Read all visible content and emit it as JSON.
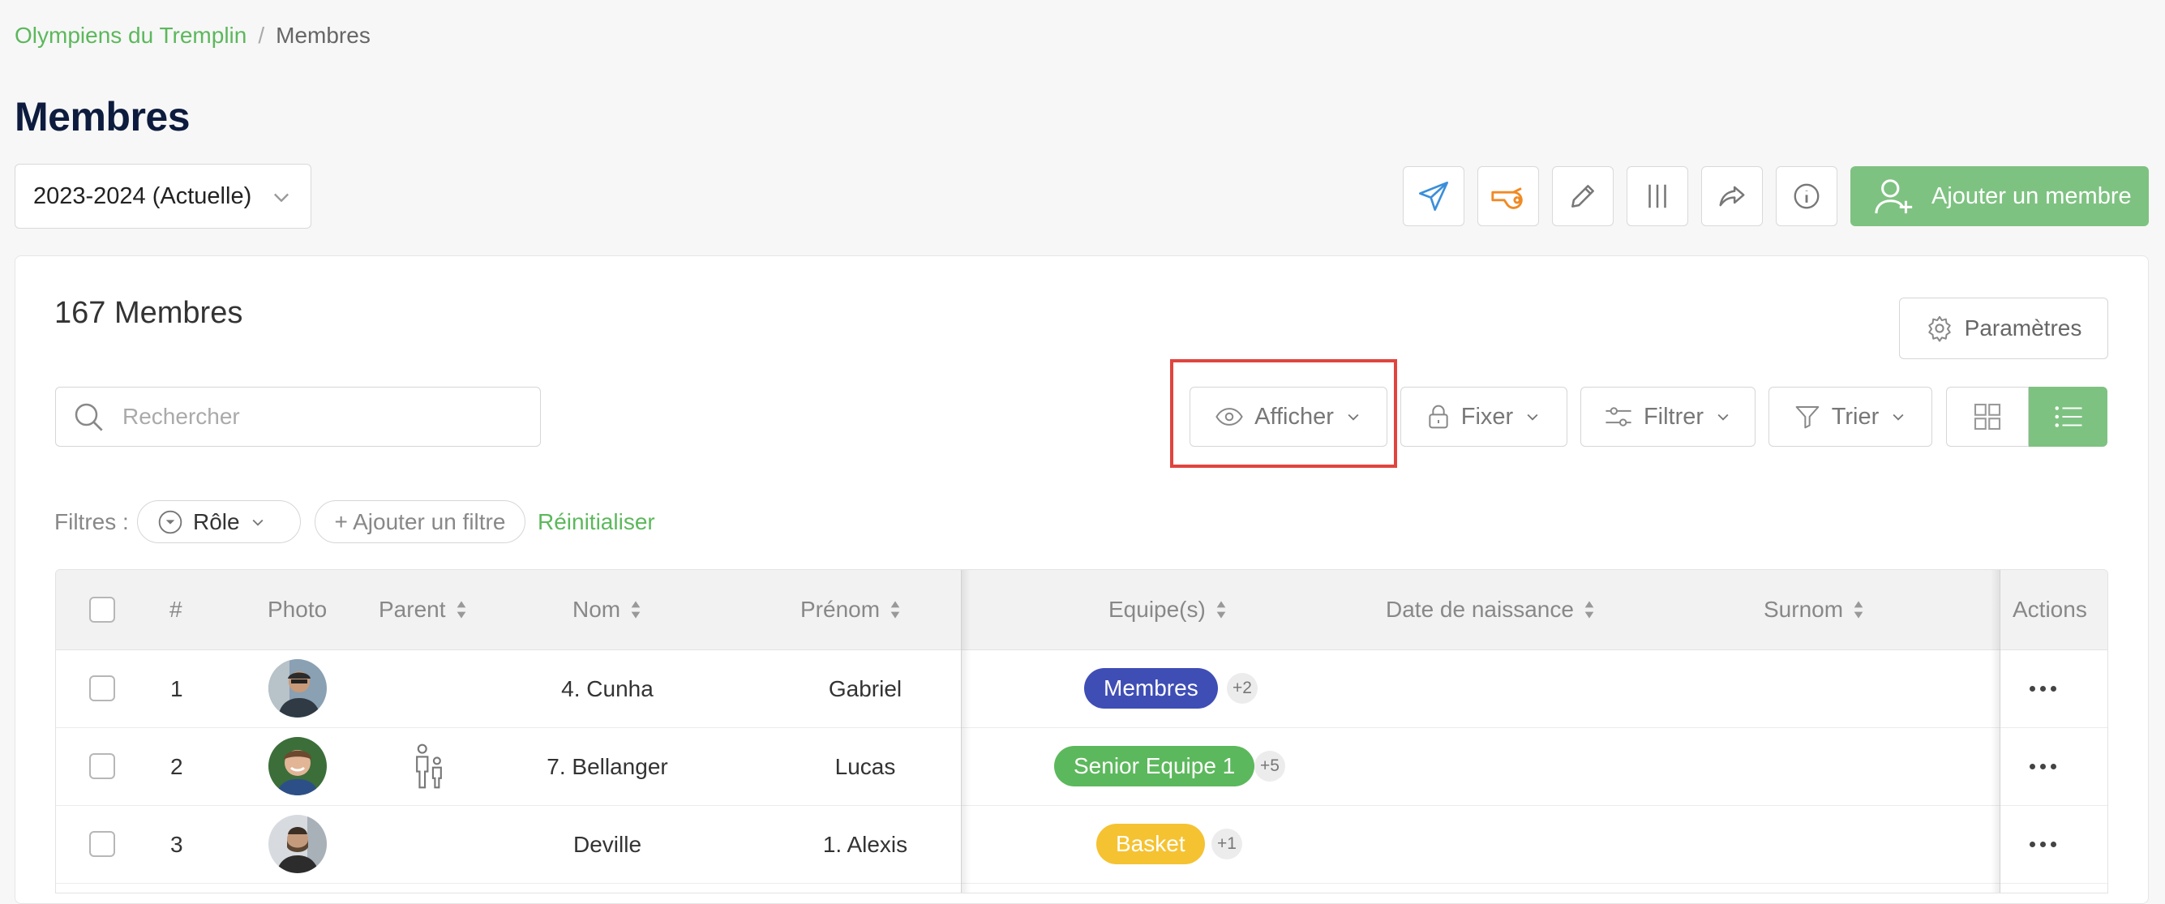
{
  "breadcrumb": {
    "club": "Olympiens du Tremplin",
    "separator": "/",
    "current": "Membres"
  },
  "page": {
    "title": "Membres"
  },
  "season": {
    "value": "2023-2024 (Actuelle)"
  },
  "toolbar": {
    "icons": [
      "send-icon",
      "whistle-icon",
      "pencil-icon",
      "columns-icon",
      "share-icon",
      "info-icon"
    ],
    "add_member_label": "Ajouter un membre"
  },
  "members": {
    "count_label": "167 Membres",
    "settings_label": "Paramètres",
    "search_placeholder": "Rechercher",
    "controls": {
      "show": "Afficher",
      "pin": "Fixer",
      "filter": "Filtrer",
      "sort": "Trier"
    },
    "filters": {
      "label": "Filtres :",
      "role": "Rôle",
      "add_filter": "+ Ajouter un filtre",
      "reset": "Réinitialiser"
    }
  },
  "table": {
    "columns": {
      "number": "#",
      "photo": "Photo",
      "parent": "Parent",
      "last_name": "Nom",
      "first_name": "Prénom",
      "teams": "Equipe(s)",
      "birth_date": "Date de naissance",
      "nickname": "Surnom",
      "actions": "Actions"
    },
    "rows": [
      {
        "num": "1",
        "last_name": "4. Cunha",
        "first_name": "Gabriel",
        "team": "Membres",
        "team_color": "#3f4eb5",
        "extra": "+2",
        "parent": false
      },
      {
        "num": "2",
        "last_name": "7. Bellanger",
        "first_name": "Lucas",
        "team": "Senior Equipe 1",
        "team_color": "#5cb85c",
        "extra": "+5",
        "parent": true
      },
      {
        "num": "3",
        "last_name": "Deville",
        "first_name": "1. Alexis",
        "team": "Basket",
        "team_color": "#f5c231",
        "extra": "+1",
        "parent": false
      }
    ]
  },
  "colors": {
    "accent": "#7ec281",
    "link": "#5cb85c",
    "highlight": "#e0443e"
  }
}
